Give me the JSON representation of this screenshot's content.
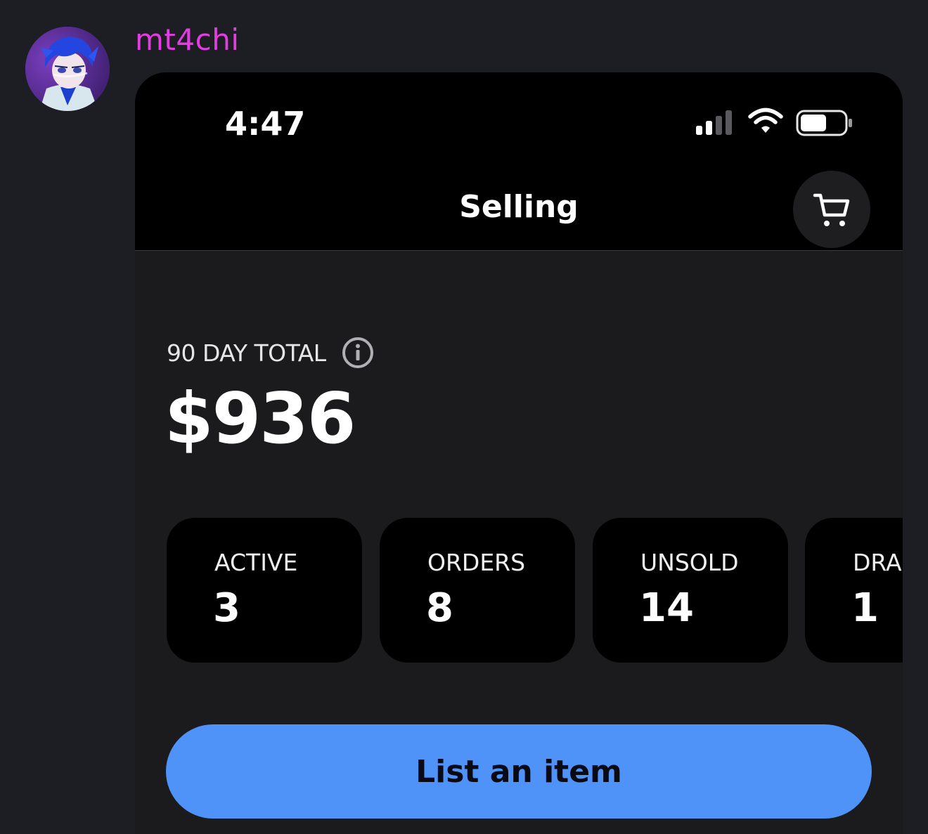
{
  "message": {
    "username": "mt4chi",
    "username_color": "#e23de0",
    "avatar_icon": "anime-character-avatar"
  },
  "status_bar": {
    "time": "4:47",
    "icons": [
      "cellular-signal-icon",
      "wifi-icon",
      "battery-icon"
    ]
  },
  "header": {
    "title": "Selling",
    "cart_icon": "shopping-cart-icon"
  },
  "summary": {
    "total_label": "90 DAY TOTAL",
    "info_icon": "info-icon",
    "total_amount": "$936"
  },
  "stats": [
    {
      "label": "ACTIVE",
      "value": "3"
    },
    {
      "label": "ORDERS",
      "value": "8"
    },
    {
      "label": "UNSOLD",
      "value": "14"
    },
    {
      "label": "DRA",
      "value": "1"
    }
  ],
  "actions": {
    "list_button_label": "List an item",
    "accent_color": "#4f93f8"
  }
}
